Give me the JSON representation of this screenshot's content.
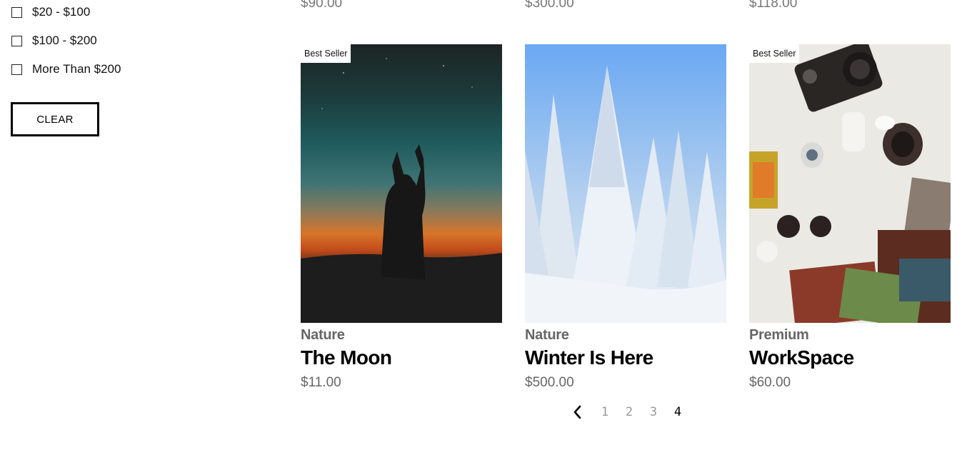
{
  "filters": {
    "price_options": [
      {
        "label": "$20 - $100",
        "checked": false
      },
      {
        "label": "$100 - $200",
        "checked": false
      },
      {
        "label": "More Than $200",
        "checked": false
      }
    ],
    "clear_label": "CLEAR"
  },
  "previous_row_prices": [
    "$90.00",
    "$300.00",
    "$118.00"
  ],
  "products": [
    {
      "badge": "Best Seller",
      "category": "Nature",
      "title": "The Moon",
      "price": "$11.00",
      "image": "silhouette-moon-sunset"
    },
    {
      "badge": "",
      "category": "Nature",
      "title": "Winter Is Here",
      "price": "$500.00",
      "image": "snowy-pine-trees"
    },
    {
      "badge": "Best Seller",
      "category": "Premium",
      "title": "WorkSpace",
      "price": "$60.00",
      "image": "camera-film-flatlay"
    }
  ],
  "pagination": {
    "pages": [
      "1",
      "2",
      "3",
      "4"
    ],
    "current": "4",
    "prev_icon": "chevron-left-icon"
  },
  "colors": {
    "muted_text": "#666666",
    "page_inactive": "#999999"
  }
}
